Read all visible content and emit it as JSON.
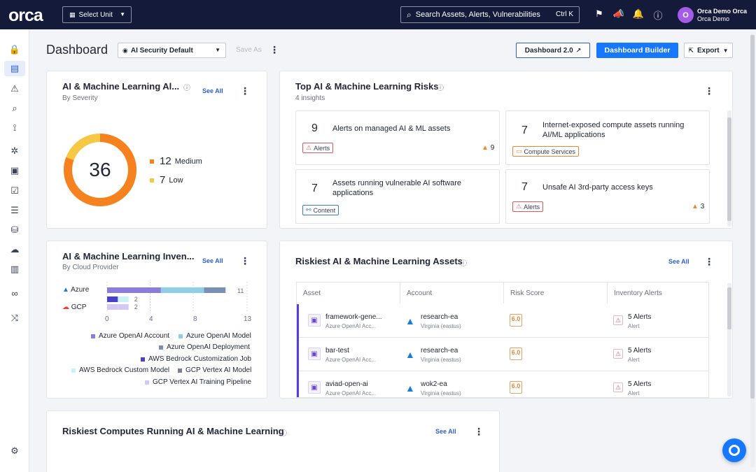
{
  "topbar": {
    "logo": "orca",
    "unit_select": "Select Unit",
    "search_placeholder": "Search Assets, Alerts, Vulnerabilities",
    "search_shortcut": "Ctrl K",
    "user_name": "Orca Demo Orca",
    "user_org": "Orca Demo",
    "avatar_initial": "O",
    "icons": [
      "flag-icon",
      "megaphone-icon",
      "bell-icon",
      "help-icon"
    ]
  },
  "sidebar": {
    "icons": [
      "lock-icon",
      "dashboard-icon",
      "alert-icon",
      "search-icon",
      "graph-icon",
      "cluster-icon",
      "toolbox-icon",
      "compliance-icon",
      "report-icon",
      "database-icon",
      "cloud-icon",
      "inventory-icon",
      "infinity-icon",
      "shuffle-icon",
      "settings-icon"
    ]
  },
  "header": {
    "title": "Dashboard",
    "view_select": "AI Security Default",
    "save_as": "Save As",
    "dashboard2": "Dashboard 2.0",
    "dashboard_builder": "Dashboard Builder",
    "export": "Export"
  },
  "severity_card": {
    "title": "AI & Machine Learning Al...",
    "subtitle": "By Severity",
    "see_all": "See All",
    "total": "36",
    "items": [
      {
        "count": "12",
        "label": "Medium",
        "color": "#f5821f"
      },
      {
        "count": "7",
        "label": "Low",
        "color": "#f5c842"
      }
    ],
    "donut": {
      "medium": 29,
      "low": 7,
      "colors": [
        "#f5821f",
        "#f7c844"
      ]
    }
  },
  "risks_card": {
    "title": "Top AI & Machine Learning Risks",
    "subtitle": "4 insights",
    "tiles": [
      {
        "num": "9",
        "text": "Alerts on managed AI & ML assets",
        "tag": "Alerts",
        "count": "9"
      },
      {
        "num": "7",
        "text": "Internet-exposed compute assets running AI/ML applications",
        "tag": "Compute Services"
      },
      {
        "num": "7",
        "text": "Assets running vulnerable AI software applications",
        "tag": "Content"
      },
      {
        "num": "7",
        "text": "Unsafe AI 3rd-party access keys",
        "tag": "Alerts",
        "count": "3"
      }
    ]
  },
  "inventory_card": {
    "title": "AI & Machine Learning Inven...",
    "subtitle": "By Cloud Provider",
    "see_all": "See All",
    "providers": [
      {
        "name": "Azure",
        "total": "11"
      },
      {
        "name": "GCP",
        "total": "2"
      }
    ],
    "chart_data": {
      "type": "bar",
      "orientation": "horizontal",
      "stacked": true,
      "categories": [
        "Azure",
        "GCP"
      ],
      "series": [
        {
          "name": "Azure OpenAI Account",
          "values": [
            5,
            0
          ],
          "color": "#8b7ddf"
        },
        {
          "name": "Azure OpenAI Model",
          "values": [
            4,
            0
          ],
          "color": "#8fd0e8"
        },
        {
          "name": "Azure OpenAI Deployment",
          "values": [
            2,
            0
          ],
          "color": "#7a8fb5"
        },
        {
          "name": "AWS Bedrock Customization Job",
          "values": [
            0,
            0
          ],
          "color": "#4a3fc7"
        },
        {
          "name": "AWS Bedrock Custom Model",
          "values": [
            0,
            0
          ],
          "color": "#c9f1f8"
        },
        {
          "name": "GCP Vertex AI Model",
          "values": [
            0,
            1
          ],
          "color": "#7c7f92"
        },
        {
          "name": "GCP Vertex AI Training Pipeline",
          "values": [
            0,
            1
          ],
          "color": "#d4c9f5"
        }
      ],
      "xticks": [
        "0",
        "4",
        "8",
        "13"
      ],
      "xlim": [
        0,
        13
      ]
    }
  },
  "assets_card": {
    "title": "Riskiest AI & Machine Learning Assets",
    "see_all": "See All",
    "columns": [
      "Asset",
      "Account",
      "Risk Score",
      "Inventory Alerts"
    ],
    "rows": [
      {
        "asset": "framework-gene...",
        "asset_type": "Azure OpenAI Acc...",
        "account": "research-ea",
        "region": "Virginia (eastus)",
        "score": "6.0",
        "alerts": "5 Alerts",
        "alerts_sub": "Alert"
      },
      {
        "asset": "bar-test",
        "asset_type": "Azure OpenAI Acc...",
        "account": "research-ea",
        "region": "Virginia (eastus)",
        "score": "6.0",
        "alerts": "5 Alerts",
        "alerts_sub": "Alert"
      },
      {
        "asset": "aviad-open-ai",
        "asset_type": "Azure OpenAI Acc...",
        "account": "wok2-ea",
        "region": "Virginia (eastus)",
        "score": "6.0",
        "alerts": "5 Alerts",
        "alerts_sub": "Alert"
      }
    ]
  },
  "computes_card": {
    "title": "Riskiest Computes Running AI & Machine Learning",
    "see_all": "See All"
  }
}
